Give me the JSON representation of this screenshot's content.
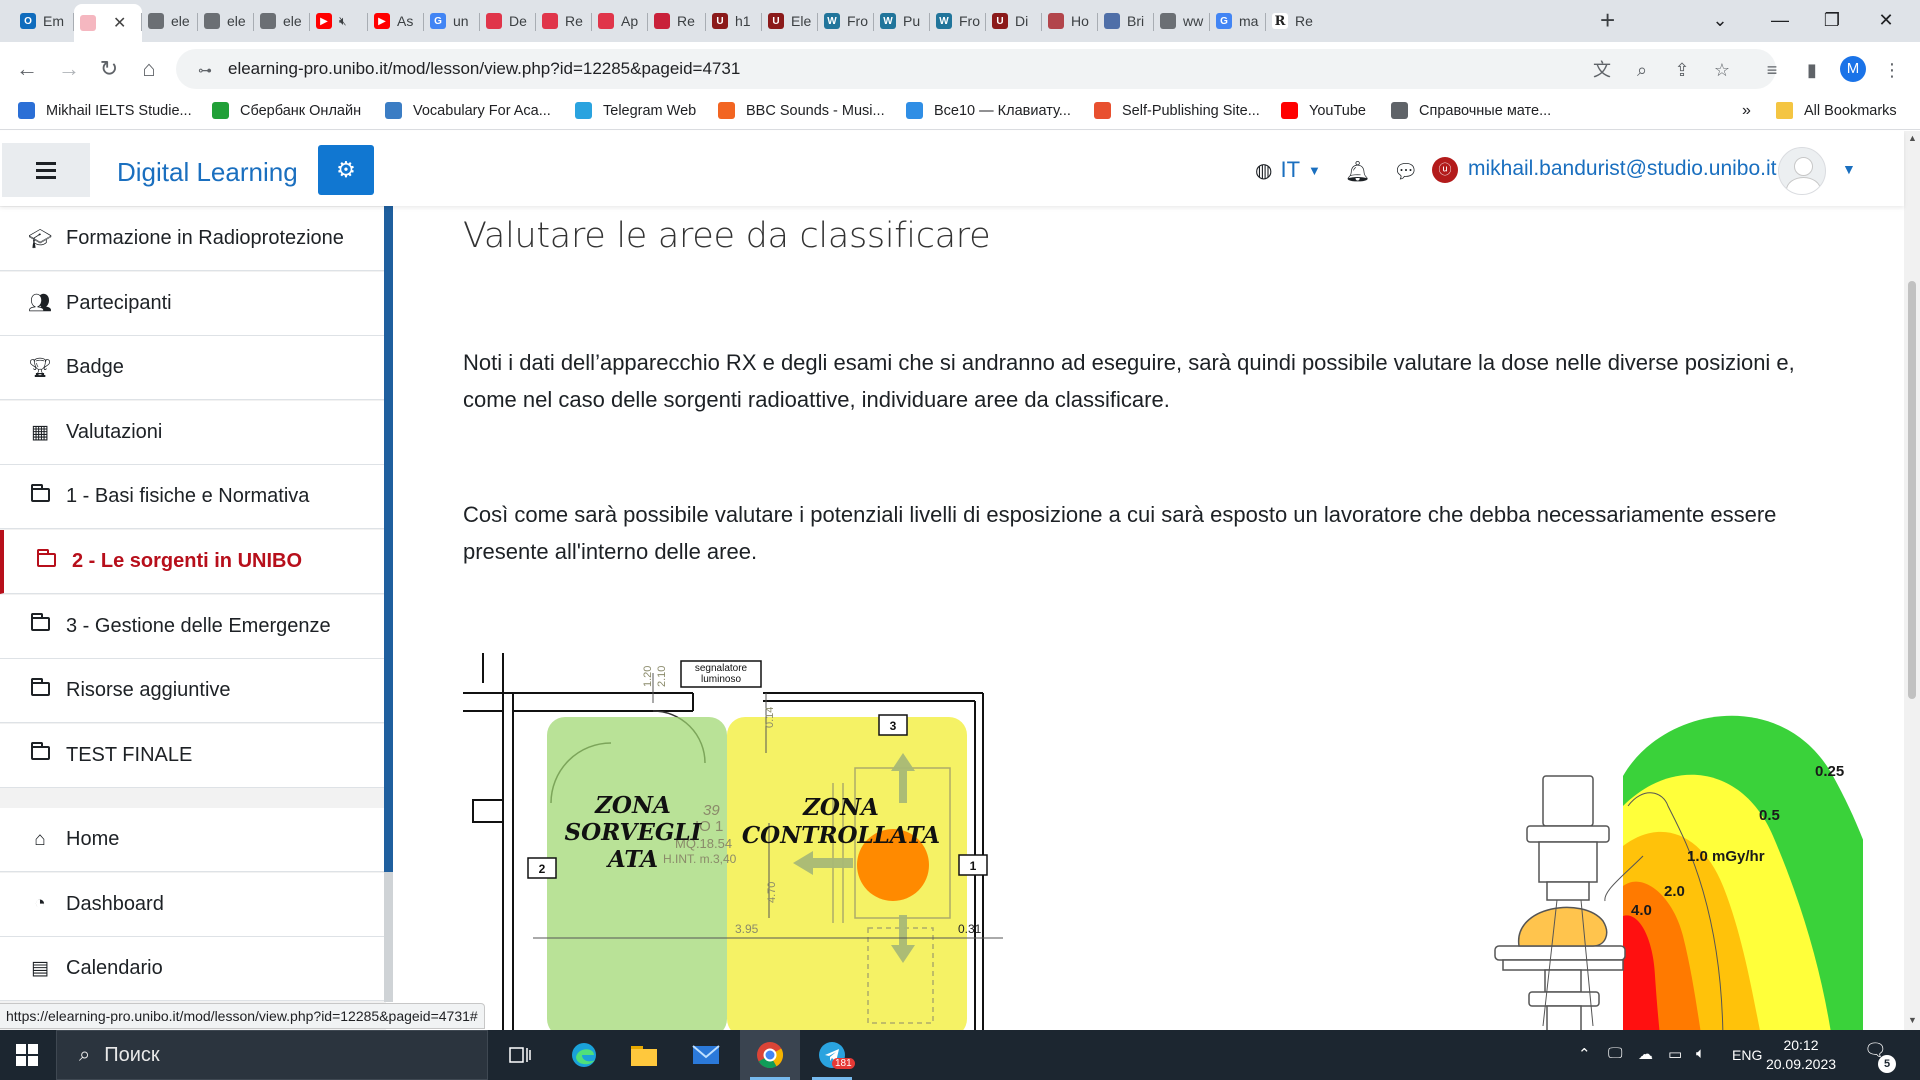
{
  "browser": {
    "tabs": [
      {
        "title": "Em",
        "icon": "outlook-icon",
        "color": "#0f6cbd",
        "glyph": "O"
      },
      {
        "title": "",
        "icon": "moodle-icon",
        "color": "#f5b7c0",
        "glyph": "",
        "active": true
      },
      {
        "title": "ele",
        "icon": "globe-icon",
        "color": "#6b6f74",
        "glyph": ""
      },
      {
        "title": "ele",
        "icon": "globe-icon",
        "color": "#6b6f74",
        "glyph": ""
      },
      {
        "title": "ele",
        "icon": "globe-icon",
        "color": "#6b6f74",
        "glyph": ""
      },
      {
        "title": "",
        "icon": "youtube-icon",
        "color": "#ff0000",
        "glyph": "▶",
        "muted": true
      },
      {
        "title": "As",
        "icon": "youtube-icon",
        "color": "#ff0000",
        "glyph": "▶"
      },
      {
        "title": "un",
        "icon": "google-icon",
        "color": "#4285f4",
        "glyph": "G"
      },
      {
        "title": "De",
        "icon": "app-icon",
        "color": "#e0354a",
        "glyph": ""
      },
      {
        "title": "Re",
        "icon": "app-icon",
        "color": "#e0354a",
        "glyph": ""
      },
      {
        "title": "Ap",
        "icon": "app-icon",
        "color": "#e0354a",
        "glyph": ""
      },
      {
        "title": "Re",
        "icon": "flag-icon",
        "color": "#c9213a",
        "glyph": ""
      },
      {
        "title": "h1",
        "icon": "shield-icon",
        "color": "#8b1a1a",
        "glyph": "U"
      },
      {
        "title": "Ele",
        "icon": "shield-icon",
        "color": "#8b1a1a",
        "glyph": "U"
      },
      {
        "title": "Fro",
        "icon": "wordpress-icon",
        "color": "#21759b",
        "glyph": "W"
      },
      {
        "title": "Pu",
        "icon": "wordpress-icon",
        "color": "#21759b",
        "glyph": "W"
      },
      {
        "title": "Fro",
        "icon": "wordpress-icon",
        "color": "#21759b",
        "glyph": "W"
      },
      {
        "title": "Di",
        "icon": "shield-icon",
        "color": "#8b1a1a",
        "glyph": "U"
      },
      {
        "title": "Ho",
        "icon": "app-icon",
        "color": "#b2454b",
        "glyph": ""
      },
      {
        "title": "Bri",
        "icon": "app-icon",
        "color": "#4f6fa8",
        "glyph": ""
      },
      {
        "title": "ww",
        "icon": "globe-icon",
        "color": "#6b6f74",
        "glyph": ""
      },
      {
        "title": "ma",
        "icon": "google-icon",
        "color": "#4285f4",
        "glyph": "G"
      },
      {
        "title": "Re",
        "icon": "reverso-icon",
        "color": "#ffffff",
        "glyph": "R"
      }
    ],
    "url": "elearning-pro.unibo.it/mod/lesson/view.php?id=12285&pageid=4731",
    "profile_initial": "M",
    "bookmarks": [
      {
        "label": "Mikhail IELTS Studie...",
        "color": "#2b6fd6"
      },
      {
        "label": "Сбербанк Онлайн",
        "color": "#21a038"
      },
      {
        "label": "Vocabulary For Aca...",
        "color": "#3b7dc4"
      },
      {
        "label": "Telegram Web",
        "color": "#2aa3df"
      },
      {
        "label": "BBC Sounds - Musi...",
        "color": "#f26522"
      },
      {
        "label": "Все10 — Клавиату...",
        "color": "#2f8ee5"
      },
      {
        "label": "Self-Publishing Site...",
        "color": "#e8502f"
      },
      {
        "label": "YouTube",
        "color": "#ff0000"
      },
      {
        "label": "Справочные мате...",
        "color": "#5f6368"
      }
    ],
    "all_bookmarks": "All Bookmarks",
    "more_bookmarks": "»"
  },
  "header": {
    "site_name": "Digital Learning",
    "language": "IT",
    "user_email": "mikhail.bandurist@studio.unibo.it"
  },
  "sidebar": {
    "items": [
      {
        "label": "Formazione in Radioprotezione",
        "icon": "graduation-cap-icon"
      },
      {
        "label": "Partecipanti",
        "icon": "users-icon"
      },
      {
        "label": "Badge",
        "icon": "trophy-icon"
      },
      {
        "label": "Valutazioni",
        "icon": "table-icon"
      },
      {
        "label": "1 - Basi fisiche e Normativa",
        "icon": "folder-icon"
      },
      {
        "label": "2 - Le sorgenti in UNIBO",
        "icon": "folder-icon",
        "active": true
      },
      {
        "label": "3 - Gestione delle Emergenze",
        "icon": "folder-icon"
      },
      {
        "label": "Risorse aggiuntive",
        "icon": "folder-icon"
      },
      {
        "label": "TEST FINALE",
        "icon": "folder-icon"
      }
    ],
    "items2": [
      {
        "label": "Home",
        "icon": "home-icon"
      },
      {
        "label": "Dashboard",
        "icon": "dashboard-icon"
      },
      {
        "label": "Calendario",
        "icon": "calendar-icon"
      }
    ]
  },
  "main": {
    "title": "Valutare le aree da classificare",
    "paragraphs": [
      "Noti i dati dell’apparecchio RX e degli esami che si andranno ad eseguire, sarà quindi possibile valutare la dose nelle diverse posizioni e, come nel caso delle sorgenti radioattive, individuare aree da classificare.",
      "Così come sarà possibile valutare i potenziali livelli di esposizione a cui sarà esposto un lavoratore che debba necessariamente essere presente all'interno delle aree."
    ],
    "floorplan": {
      "signal_label_1": "segnalatore",
      "signal_label_2": "luminoso",
      "zone_sorvegliata": [
        "ZONA",
        "SORVEGLI",
        "ATA"
      ],
      "zone_controllata": [
        "ZONA",
        "CONTROLLATA"
      ],
      "room_lines": [
        "39",
        "IO 1",
        "MQ.18.54",
        "H.INT. m.3,40"
      ],
      "dims": [
        "1.20",
        "2.10",
        "0.14",
        "4.70",
        "3.95",
        "0.31"
      ],
      "markers": [
        "3",
        "2",
        "1"
      ]
    },
    "dosemap": {
      "labels": [
        "0.25",
        "0.5",
        "1.0 mGy/hr",
        "2.0",
        "4.0"
      ]
    }
  },
  "status_url": "https://elearning-pro.unibo.it/mod/lesson/view.php?id=12285&pageid=4731#",
  "taskbar": {
    "search_placeholder": "Поиск",
    "language": "ENG",
    "time": "20:12",
    "date": "20.09.2023",
    "telegram_badge": "181",
    "notifications": "5"
  }
}
